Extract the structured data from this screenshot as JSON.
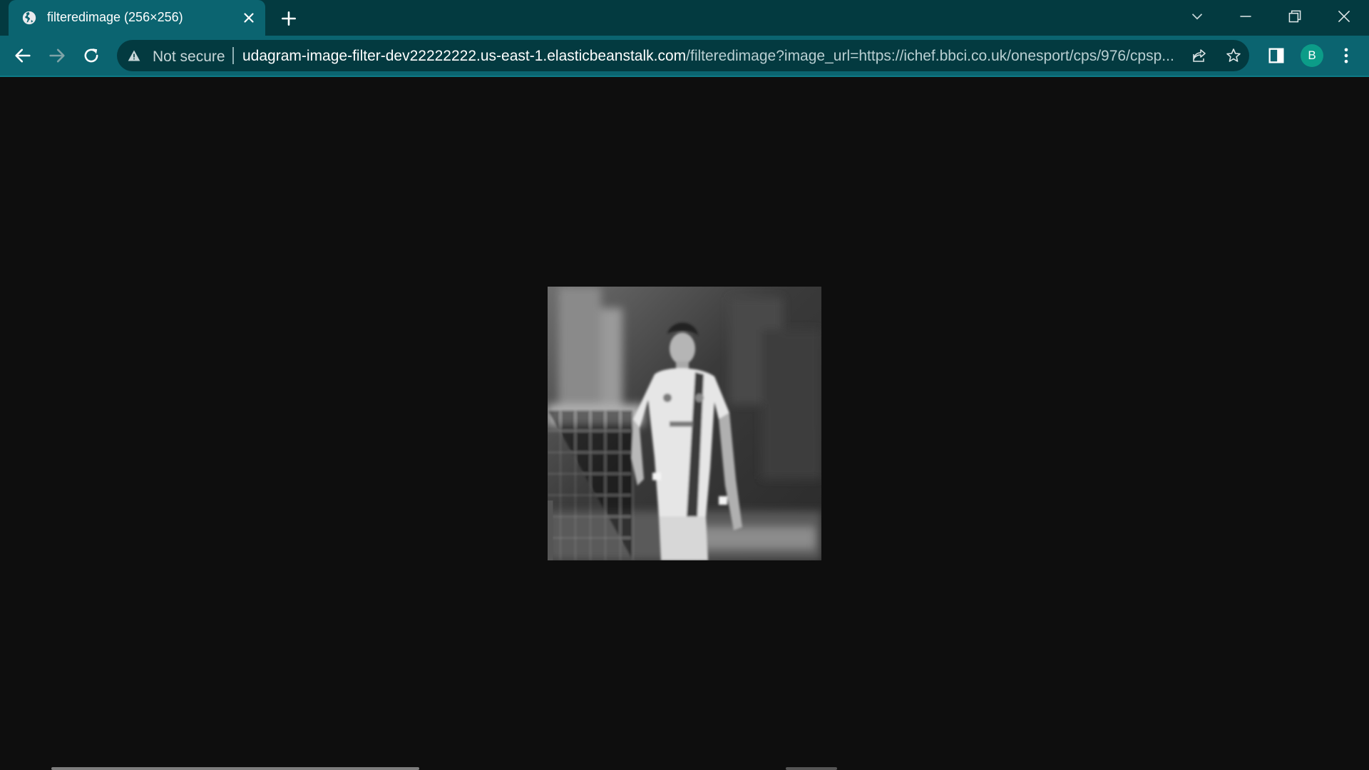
{
  "tab": {
    "title": "filteredimage (256×256)",
    "favicon": "globe-icon"
  },
  "toolbar": {
    "security_label": "Not secure",
    "security_icon": "warning-icon",
    "url_host": "udagram-image-filter-dev22222222.us-east-1.elasticbeanstalk.com",
    "url_path": "/filteredimage?image_url=https://ichef.bbci.co.uk/onesport/cps/976/cpsp...",
    "profile_initial": "B"
  },
  "colors": {
    "tabstrip_bg": "#033a40",
    "active_tab_bg": "#0b6470",
    "omnibox_bg": "#033a40",
    "page_bg": "#0e0e0e",
    "avatar_bg": "#0c9c88"
  },
  "content": {
    "image": "grayscale photo of a footballer in a white kit",
    "image_filter": "grayscale",
    "image_natural_size": "256×256"
  }
}
